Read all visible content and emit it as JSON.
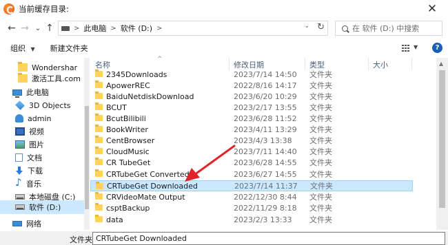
{
  "window": {
    "title": "当前缓存目录:",
    "close_glyph": "✕"
  },
  "nav_buttons": {
    "back": "←",
    "forward": "→",
    "recent": "⌄",
    "up": "↑"
  },
  "address": {
    "crumbs": [
      "此电脑",
      "软件 (D:)"
    ],
    "separator": ">",
    "drop": "⌄",
    "refresh": "↻"
  },
  "search": {
    "placeholder": "在 软件 (D:) 中搜索"
  },
  "toolbar": {
    "organize": "组织",
    "organize_caret": "▼",
    "new_folder": "新建文件夹",
    "view_caret": "▼",
    "help": "?"
  },
  "sidebar": {
    "items": [
      {
        "label": "Wondershar",
        "icon": "folder-icon"
      },
      {
        "label": "激活工具.com",
        "icon": "folder-icon"
      },
      {
        "label": "此电脑",
        "icon": "computer-icon"
      },
      {
        "label": "3D Objects",
        "icon": "3d-objects-icon"
      },
      {
        "label": "admin",
        "icon": "user-folder-icon"
      },
      {
        "label": "视频",
        "icon": "video-icon"
      },
      {
        "label": "图片",
        "icon": "picture-icon"
      },
      {
        "label": "文档",
        "icon": "document-icon"
      },
      {
        "label": "下载",
        "icon": "download-icon"
      },
      {
        "label": "音乐",
        "icon": "music-icon"
      },
      {
        "label": "本地磁盘 (C:)",
        "icon": "local-disk-icon"
      },
      {
        "label": "软件 (D:)",
        "icon": "drive-icon"
      },
      {
        "label": "网络",
        "icon": "network-icon"
      }
    ]
  },
  "columns": {
    "name": "名称",
    "date": "修改日期",
    "type": "类型",
    "size": "大小",
    "sort_indicator": "^"
  },
  "files": [
    {
      "name": "2345Downloads",
      "date": "2023/7/14 14:50",
      "type": "文件夹"
    },
    {
      "name": "ApowerREC",
      "date": "2022/8/16 14:17",
      "type": "文件夹"
    },
    {
      "name": "BaiduNetdiskDownload",
      "date": "2023/6/20 10:29",
      "type": "文件夹"
    },
    {
      "name": "BCUT",
      "date": "2023/2/17 13:55",
      "type": "文件夹"
    },
    {
      "name": "BcutBilibili",
      "date": "2023/6/28 11:52",
      "type": "文件夹"
    },
    {
      "name": "BookWriter",
      "date": "2023/4/11 13:29",
      "type": "文件夹"
    },
    {
      "name": "CentBrowser",
      "date": "2023/4/3 13:38",
      "type": "文件夹"
    },
    {
      "name": "CloudMusic",
      "date": "2023/7/11 14:40",
      "type": "文件夹"
    },
    {
      "name": "CR TubeGet",
      "date": "2023/6/28 14:55",
      "type": "文件夹"
    },
    {
      "name": "CRTubeGet Converted",
      "date": "2023/6/27 14:55",
      "type": "文件夹"
    },
    {
      "name": "CRTubeGet Downloaded",
      "date": "2023/7/14 11:37",
      "type": "文件夹"
    },
    {
      "name": "CRVideoMate Output",
      "date": "2022/12/30 8:44",
      "type": "文件夹"
    },
    {
      "name": "csptBackup",
      "date": "2022/11/29 8:18",
      "type": "文件夹"
    },
    {
      "name": "data",
      "date": "2023/2/3 13:33",
      "type": "文件夹"
    }
  ],
  "selected_index": 10,
  "filename": {
    "label": "文件夹:",
    "value": "CRTubeGet Downloaded"
  },
  "colors": {
    "selection": "#cce8ff",
    "selection_border": "#99d1ff",
    "annotation_arrow": "#e0242a",
    "folder": "#ffd35c"
  }
}
